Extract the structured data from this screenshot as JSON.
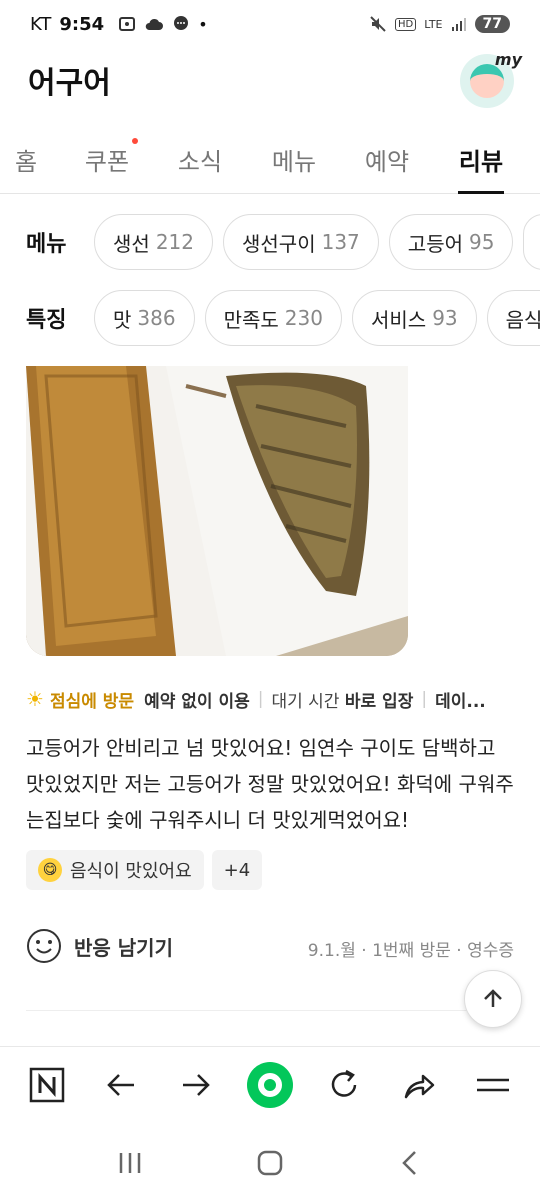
{
  "status": {
    "carrier": "KT",
    "time": "9:54",
    "network": "LTE",
    "battery": "77"
  },
  "header": {
    "title": "어구어",
    "avatar_label": "my"
  },
  "tabs": [
    {
      "label": "홈"
    },
    {
      "label": "쿠폰"
    },
    {
      "label": "소식"
    },
    {
      "label": "메뉴"
    },
    {
      "label": "예약"
    },
    {
      "label": "리뷰"
    }
  ],
  "filters": {
    "menu": {
      "label": "메뉴",
      "chips": [
        {
          "name": "생선",
          "count": "212"
        },
        {
          "name": "생선구이",
          "count": "137"
        },
        {
          "name": "고등어",
          "count": "95"
        }
      ]
    },
    "feature": {
      "label": "특징",
      "chips": [
        {
          "name": "맛",
          "count": "386"
        },
        {
          "name": "만족도",
          "count": "230"
        },
        {
          "name": "서비스",
          "count": "93"
        },
        {
          "name": "음식량",
          "count": ""
        }
      ]
    }
  },
  "review": {
    "visit_time": "점심에 방문",
    "reservation": "예약 없이 이용",
    "wait_label": "대기 시간",
    "wait_value": "바로 입장",
    "more": "데이...",
    "text": "고등어가 안비리고 넘 맛있어요! 임연수 구이도 담백하고 맛있었지만 저는 고등어가 정말 맛있었어요! 화덕에 구워주는집보다 숯에 구워주시니 더 맛있게먹었어요!",
    "tags": [
      {
        "label": "음식이 맛있어요"
      }
    ],
    "more_tags": "+4",
    "react_label": "반응 남기기",
    "meta": "9.1.월 · 1번째 방문 · 영수증"
  },
  "colors": {
    "accent": "#03c75a",
    "lunch": "#c98a00",
    "notify": "#ff4a3a"
  },
  "icons": {
    "browser": [
      "naver-n-icon",
      "back-arrow-icon",
      "forward-arrow-icon",
      "home-green-icon",
      "refresh-icon",
      "share-icon",
      "menu-icon"
    ],
    "system": [
      "recent-apps-icon",
      "home-icon",
      "back-icon"
    ]
  }
}
